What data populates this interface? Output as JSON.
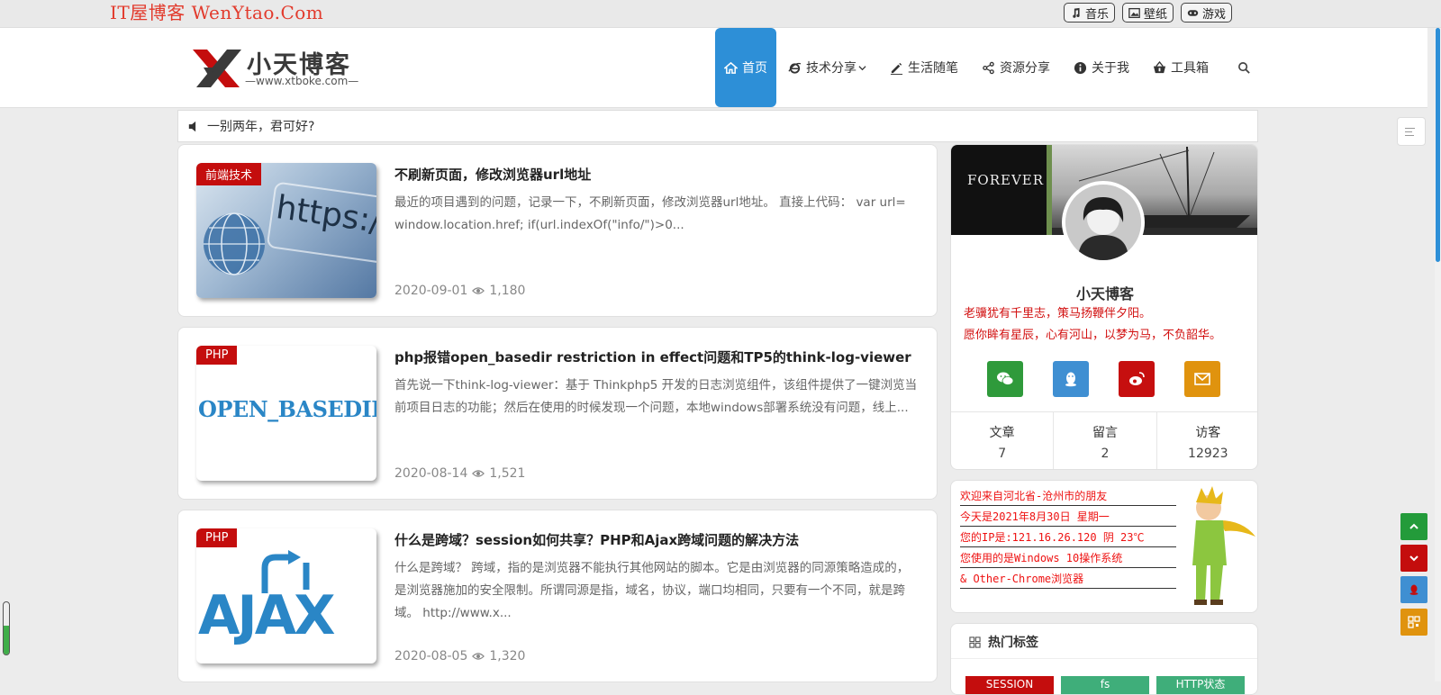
{
  "topbar": {
    "brand": "IT屋博客 WenYtao.Com",
    "buttons": [
      {
        "label": "音乐",
        "icon": "music-icon"
      },
      {
        "label": "壁纸",
        "icon": "image-icon"
      },
      {
        "label": "游戏",
        "icon": "gamepad-icon"
      }
    ]
  },
  "header": {
    "logo_text": "小天博客",
    "logo_url": "—www.xtboke.com—",
    "nav": [
      {
        "label": "首页",
        "icon": "home-icon",
        "active": true
      },
      {
        "label": "技术分享",
        "icon": "ie-icon"
      },
      {
        "label": "生活随笔",
        "icon": "pencil-icon"
      },
      {
        "label": "资源分享",
        "icon": "share-icon"
      },
      {
        "label": "关于我",
        "icon": "info-icon"
      },
      {
        "label": "工具箱",
        "icon": "basket-icon"
      }
    ]
  },
  "notice": {
    "text": "一别两年，君可好?"
  },
  "posts": [
    {
      "category": "前端技术",
      "title": "不刷新页面，修改浏览器url地址",
      "excerpt": "最近的项目遇到的问题，记录一下，不刷新页面，修改浏览器url地址。 直接上代码： var url= window.location.href; if(url.indexOf(\"info/\")>0...",
      "date": "2020-09-01",
      "views": "1,180",
      "thumb_text": "https://ww"
    },
    {
      "category": "PHP",
      "title": "php报错open_basedir restriction in effect问题和TP5的think-log-viewer",
      "excerpt": "首先说一下think-log-viewer：基于 Thinkphp5 开发的日志浏览组件，该组件提供了一键浏览当前项目日志的功能；然后在使用的时候发现一个问题，本地windows部署系统没有问题，线上...",
      "date": "2020-08-14",
      "views": "1,521",
      "thumb_text": "OPEN_BASEDIR"
    },
    {
      "category": "PHP",
      "title": "什么是跨域？session如何共享？PHP和Ajax跨域问题的解决方法",
      "excerpt": "什么是跨域？ 跨域，指的是浏览器不能执行其他网站的脚本。它是由浏览器的同源策略造成的，是浏览器施加的安全限制。所谓同源是指，域名，协议，端口均相同，只要有一个不同，就是跨域。 http://www.x...",
      "date": "2020-08-05",
      "views": "1,320",
      "thumb_text": "AJAX"
    }
  ],
  "profile": {
    "banner_text": "FOREVER",
    "name": "小天博客",
    "motto1": "老骥犹有千里志，策马扬鞭伴夕阳。",
    "motto2": "愿你眸有星辰，心有河山，以梦为马，不负韶华。",
    "socials": [
      {
        "name": "wechat",
        "color": "#2f9a3b"
      },
      {
        "name": "qq",
        "color": "#3f8fd2"
      },
      {
        "name": "weibo",
        "color": "#c60f0f"
      },
      {
        "name": "email",
        "color": "#e0930e"
      }
    ],
    "stats": [
      {
        "label": "文章",
        "value": "7"
      },
      {
        "label": "留言",
        "value": "2"
      },
      {
        "label": "访客",
        "value": "12923"
      }
    ]
  },
  "greeting": {
    "lines": [
      "欢迎来自河北省-沧州市的朋友",
      "今天是2021年8月30日 星期一",
      "您的IP是:121.16.26.120  阴 23℃",
      "您使用的是Windows 10操作系统",
      "& Other-Chrome浏览器"
    ]
  },
  "tags": {
    "title": "热门标签",
    "items": [
      {
        "label": "SESSION",
        "color": "#c40d0d"
      },
      {
        "label": "fs",
        "color": "#3fae7a"
      },
      {
        "label": "HTTP状态",
        "color": "#3fae7a"
      }
    ]
  },
  "colors": {
    "accent": "#2d8fd7",
    "category": "#c40d0d",
    "up": "#239b3a",
    "down": "#c40d0d",
    "qq": "#3f8fd2",
    "qr": "#e0930e"
  }
}
